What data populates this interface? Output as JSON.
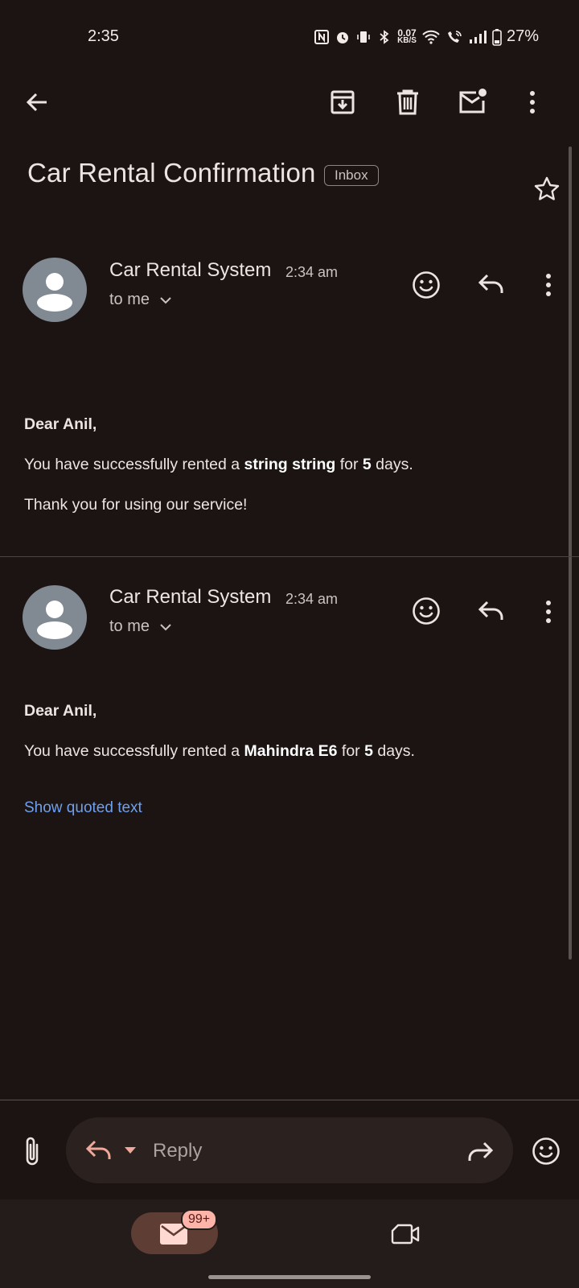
{
  "status_bar": {
    "time": "2:35",
    "net_speed_value": "0.07",
    "net_speed_unit": "KB/S",
    "battery": "27%"
  },
  "toolbar": {
    "icons": [
      "back-arrow-icon",
      "archive-icon",
      "delete-icon",
      "mark-unread-icon",
      "more-vert-icon"
    ]
  },
  "subject": {
    "title": "Car Rental Confirmation",
    "label": "Inbox"
  },
  "messages": [
    {
      "sender": "Car Rental System",
      "time": "2:34 am",
      "recipient": "to me",
      "greeting": "Dear Anil,",
      "line_prefix": "You have successfully rented a ",
      "car": "string string",
      "line_mid": " for ",
      "days": "5",
      "line_suffix": " days.",
      "closing": "Thank you for using our service!"
    },
    {
      "sender": "Car Rental System",
      "time": "2:34 am",
      "recipient": "to me",
      "greeting": "Dear Anil,",
      "line_prefix": "You have successfully rented a ",
      "car": "Mahindra E6",
      "line_mid": " for ",
      "days": "5",
      "line_suffix": " days.",
      "quoted_link": "Show quoted text"
    }
  ],
  "reply_bar": {
    "placeholder": "Reply"
  },
  "bottom_nav": {
    "mail_badge": "99+"
  },
  "colors": {
    "background": "#1b1412",
    "accent": "#f0a89b",
    "link": "#6ea0f0",
    "avatar": "#818a93"
  }
}
